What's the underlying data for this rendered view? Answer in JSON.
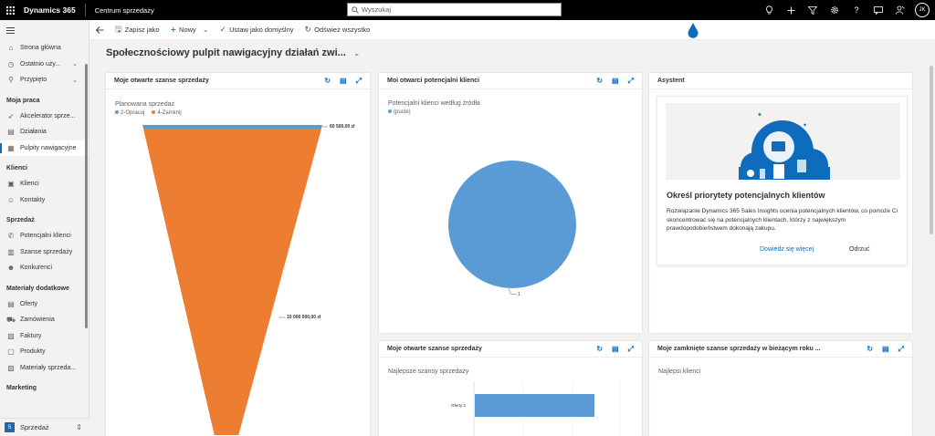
{
  "topbar": {
    "app_name": "Dynamics 365",
    "area_name": "Centrum sprzedaży",
    "search_placeholder": "Wyszukaj",
    "user_initials": "JK"
  },
  "commandbar": {
    "save_as": "Zapisz jako",
    "new": "Nowy",
    "set_default": "Ustaw jako domyślny",
    "refresh_all": "Odśwież wszystko"
  },
  "sidebar": {
    "top_items": [
      {
        "label": "Strona główna",
        "icon": "home-icon"
      },
      {
        "label": "Ostatnio uży...",
        "icon": "clock-icon"
      },
      {
        "label": "Przypięto",
        "icon": "pin-icon"
      }
    ],
    "groups": [
      {
        "title": "Moja praca",
        "items": [
          "Akcelerator sprze...",
          "Działania",
          "Pulpity nawigacyjne"
        ]
      },
      {
        "title": "Klienci",
        "items": [
          "Klienci",
          "Kontakty"
        ]
      },
      {
        "title": "Sprzedaż",
        "items": [
          "Potencjalni klienci",
          "Szanse sprzedaży",
          "Konkurenci"
        ]
      },
      {
        "title": "Materiały dodatkowe",
        "items": [
          "Oferty",
          "Zamówienia",
          "Faktury",
          "Produkty",
          "Materiały sprzeda..."
        ]
      },
      {
        "title": "Marketing",
        "items": []
      }
    ],
    "area": {
      "letter": "S",
      "label": "Sprzedaż"
    }
  },
  "dashboard": {
    "title": "Społecznościowy pulpit nawigacyjny działań zwi..."
  },
  "cards": {
    "opportunities": {
      "title": "Moje otwarte szanse sprzedaży",
      "subtitle": "Planowana sprzedaż",
      "legend": [
        {
          "label": "2-Opracuj",
          "color": "#5b9bd5"
        },
        {
          "label": "4-Zamknij",
          "color": "#ed7d31"
        }
      ],
      "label_top": "60 500,00 zł",
      "label_mid": "10 000 000,00 zł"
    },
    "leads": {
      "title": "Moi otwarci potencjalni klienci",
      "subtitle": "Potencjalni klienci według źródła",
      "legend_label": "(puste)",
      "legend_color": "#5b9bd5",
      "slice_label": "1"
    },
    "assistant": {
      "title": "Asystent",
      "card_title": "Określ priorytety potencjalnych klientów",
      "card_body": "Rozwiązanie Dynamics 365 Sales Insights ocenia potencjalnych klientów, co pomoże Ci skoncentrować się na potencjalnych klientach, którzy z największym prawdopodobieństwem dokonają zakupu.",
      "learn_more": "Dowiedz się więcej",
      "dismiss": "Odrzuć"
    },
    "top_opps": {
      "title": "Moje otwarte szanse sprzedaży",
      "subtitle": "Najlepsze szansy sprzedaży",
      "bar_label": "Oferty 2"
    },
    "closed": {
      "title": "Moje zamknięte szanse sprzedaży w bieżącym roku ...",
      "subtitle": "Najlepsi klienci"
    }
  }
}
